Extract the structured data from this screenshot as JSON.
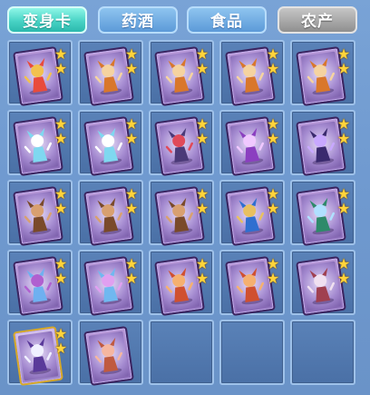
{
  "tabs": [
    {
      "label": "变身卡",
      "state": "active"
    },
    {
      "label": "药酒",
      "state": "normal"
    },
    {
      "label": "食品",
      "state": "normal"
    },
    {
      "label": "农产",
      "state": "grey"
    }
  ],
  "colors": {
    "star": "#ffd43b",
    "card_border": "#3b2460",
    "slot_bg": "#4a70a6"
  },
  "inventory": [
    {
      "name": "monkey-king-card",
      "stars": 2,
      "colors": [
        "#e94b3c",
        "#f2c14e"
      ]
    },
    {
      "name": "fox-warrior-card",
      "stars": 2,
      "colors": [
        "#d9772b",
        "#f5d3a0"
      ]
    },
    {
      "name": "fox-warrior-card",
      "stars": 2,
      "colors": [
        "#d9772b",
        "#f5d3a0"
      ]
    },
    {
      "name": "fox-warrior-card",
      "stars": 2,
      "colors": [
        "#d9772b",
        "#f5d3a0"
      ]
    },
    {
      "name": "fox-warrior-card",
      "stars": 2,
      "colors": [
        "#d9772b",
        "#f5d3a0"
      ]
    },
    {
      "name": "white-rabbit-card",
      "stars": 2,
      "colors": [
        "#7fd8f0",
        "#ffffff"
      ]
    },
    {
      "name": "white-rabbit-card",
      "stars": 2,
      "colors": [
        "#7fd8f0",
        "#ffffff"
      ]
    },
    {
      "name": "dark-knight-card",
      "stars": 2,
      "colors": [
        "#4b3a78",
        "#e04a5a"
      ]
    },
    {
      "name": "sorceress-card",
      "stars": 2,
      "colors": [
        "#8b3fc0",
        "#f0c8ff"
      ]
    },
    {
      "name": "centaur-card",
      "stars": 2,
      "colors": [
        "#3a2a6e",
        "#c8a8ff"
      ]
    },
    {
      "name": "beast-rider-card",
      "stars": 2,
      "colors": [
        "#7a4a2a",
        "#d8a070"
      ]
    },
    {
      "name": "beast-rider-card",
      "stars": 2,
      "colors": [
        "#7a4a2a",
        "#d8a070"
      ]
    },
    {
      "name": "beast-rider-card",
      "stars": 2,
      "colors": [
        "#7a4a2a",
        "#d8a070"
      ]
    },
    {
      "name": "blue-mage-card",
      "stars": 2,
      "colors": [
        "#2f6fd0",
        "#e8c060"
      ]
    },
    {
      "name": "jade-warrior-card",
      "stars": 2,
      "colors": [
        "#2e8a6a",
        "#b0e0ff"
      ]
    },
    {
      "name": "peacock-fairy-card",
      "stars": 2,
      "colors": [
        "#6fb0f0",
        "#b060d0"
      ]
    },
    {
      "name": "butterfly-fairy-card",
      "stars": 2,
      "colors": [
        "#70b8f0",
        "#e0a0f0"
      ]
    },
    {
      "name": "boar-rider-card",
      "stars": 2,
      "colors": [
        "#d05030",
        "#f5b070"
      ]
    },
    {
      "name": "boar-rider-card",
      "stars": 2,
      "colors": [
        "#d05030",
        "#f5b070"
      ]
    },
    {
      "name": "winged-dancer-card",
      "stars": 2,
      "colors": [
        "#a04050",
        "#f0e0f0"
      ]
    },
    {
      "name": "violet-general-card",
      "stars": 2,
      "colors": [
        "#5a3a9a",
        "#f0f0ff"
      ],
      "gold": true
    },
    {
      "name": "pig-card",
      "stars": 0,
      "colors": [
        "#c05a40",
        "#f5b6a0"
      ]
    },
    {
      "name": "empty",
      "stars": 0
    },
    {
      "name": "empty",
      "stars": 0
    },
    {
      "name": "empty",
      "stars": 0
    }
  ]
}
